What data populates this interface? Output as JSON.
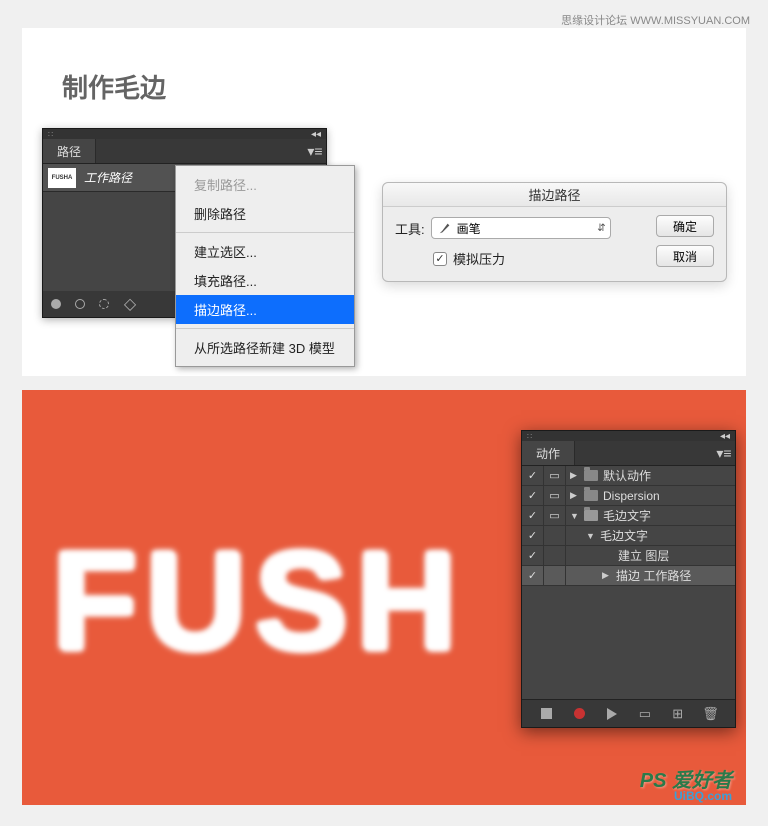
{
  "header": {
    "watermark": "思缘设计论坛  WWW.MISSYUAN.COM"
  },
  "title": "制作毛边",
  "pathsPanel": {
    "tab": "路径",
    "item": {
      "thumb": "FUSHA",
      "label": "工作路径"
    }
  },
  "contextMenu": {
    "items": [
      {
        "label": "复制路径...",
        "disabled": true
      },
      {
        "label": "删除路径",
        "disabled": false
      },
      {
        "label": "建立选区...",
        "disabled": false,
        "sepBefore": true
      },
      {
        "label": "填充路径...",
        "disabled": false
      },
      {
        "label": "描边路径...",
        "disabled": false,
        "highlighted": true
      },
      {
        "label": "从所选路径新建 3D 模型",
        "disabled": false,
        "sepBefore": true
      }
    ]
  },
  "strokeDialog": {
    "title": "描边路径",
    "toolLabel": "工具:",
    "toolValue": "画笔",
    "simulatePressure": "模拟压力",
    "ok": "确定",
    "cancel": "取消"
  },
  "canvas": {
    "text": "FUSH"
  },
  "actionsPanel": {
    "tab": "动作",
    "rows": [
      {
        "check": true,
        "mode": true,
        "indent": 1,
        "arrow": "▶",
        "folder": "closed",
        "label": "默认动作"
      },
      {
        "check": true,
        "mode": true,
        "indent": 1,
        "arrow": "▶",
        "folder": "closed",
        "label": "Dispersion"
      },
      {
        "check": true,
        "mode": true,
        "indent": 1,
        "arrow": "▼",
        "folder": "open",
        "label": "毛边文字"
      },
      {
        "check": true,
        "mode": false,
        "indent": 2,
        "arrow": "▼",
        "folder": "",
        "label": "毛边文字"
      },
      {
        "check": true,
        "mode": false,
        "indent": 3,
        "arrow": "",
        "folder": "",
        "label": "建立 图层"
      },
      {
        "check": true,
        "mode": false,
        "indent": 3,
        "arrow": "▶",
        "folder": "",
        "label": "描边 工作路径",
        "selected": true
      }
    ]
  },
  "watermark": {
    "logo": "PS 爱好者",
    "site": "UiBQ.com"
  }
}
